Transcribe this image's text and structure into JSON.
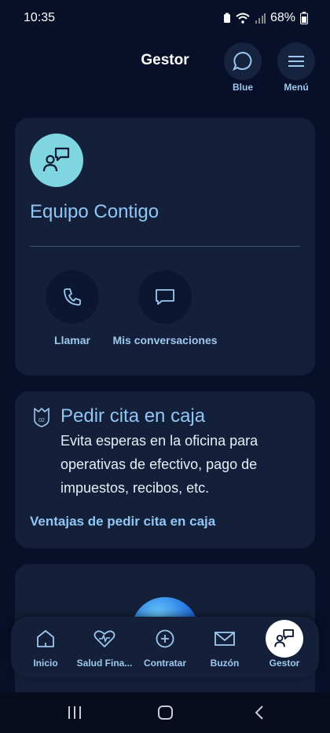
{
  "status": {
    "time": "10:35",
    "battery": "68%"
  },
  "header": {
    "title": "Gestor",
    "blue_label": "Blue",
    "menu_label": "Menú"
  },
  "team_card": {
    "title": "Equipo Contigo",
    "actions": [
      {
        "label": "Llamar",
        "icon": "phone-icon"
      },
      {
        "label": "Mis conversaciones",
        "icon": "chat-icon"
      }
    ]
  },
  "appointment_card": {
    "title": "Pedir cita en caja",
    "description": "Evita esperas en la oficina para operativas de efectivo, pago de impuestos, recibos, etc.",
    "link": "Ventajas de pedir cita en caja",
    "badge": "02"
  },
  "tabs": [
    {
      "label": "Inicio",
      "icon": "home-icon"
    },
    {
      "label": "Salud Fina...",
      "icon": "heart-pulse-icon"
    },
    {
      "label": "Contratar",
      "icon": "plus-circle-icon"
    },
    {
      "label": "Buzón",
      "icon": "mail-icon"
    },
    {
      "label": "Gestor",
      "icon": "advisor-icon",
      "active": true
    }
  ],
  "colors": {
    "background": "#071028",
    "card": "#142039",
    "accent": "#8fc6f5",
    "avatar": "#7fd6e0"
  }
}
